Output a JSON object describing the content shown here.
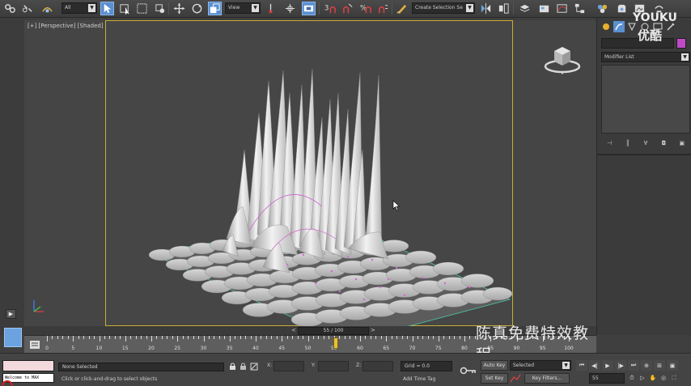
{
  "toolbar": {
    "filter_dropdown": "All",
    "ref_coord_dropdown": "View",
    "selection_set_dropdown": "Create Selection Se",
    "snap_labels": [
      "3",
      "n",
      "%",
      "n"
    ]
  },
  "viewport": {
    "label": "[+] [Perspective] [Shaded]"
  },
  "command_panel": {
    "modifier_list": "Modifier List"
  },
  "watermark": {
    "youku_en": "YOUKU",
    "youku_zh": "优酷",
    "chinese_title": "陈真免费特效教程"
  },
  "timeslider": {
    "frame_display": "55 / 100",
    "prev_arrow": "<",
    "next_arrow": ">"
  },
  "trackbar": {
    "ticks": [
      "0",
      "5",
      "10",
      "15",
      "20",
      "25",
      "30",
      "35",
      "40",
      "45",
      "50",
      "55",
      "60",
      "65",
      "70",
      "75",
      "80",
      "85",
      "90",
      "95",
      "100"
    ]
  },
  "status": {
    "maxscript_text": "Welcome to MAX",
    "selection": "None Selected",
    "prompt": "Click or click-and-drag to select objects",
    "x_label": "X:",
    "y_label": "Y:",
    "z_label": "Z:",
    "grid": "Grid = 0.0",
    "add_time_tag": "Add Time Tag",
    "auto_key": "Auto Key",
    "set_key": "Set Key",
    "selected_dropdown": "Selected",
    "key_filters": "Key Filters...",
    "current_frame": "55"
  },
  "colors": {
    "viewport_border": "#c9ad37",
    "active_button": "#5a8fd0",
    "object_color": "#c04ac8"
  }
}
